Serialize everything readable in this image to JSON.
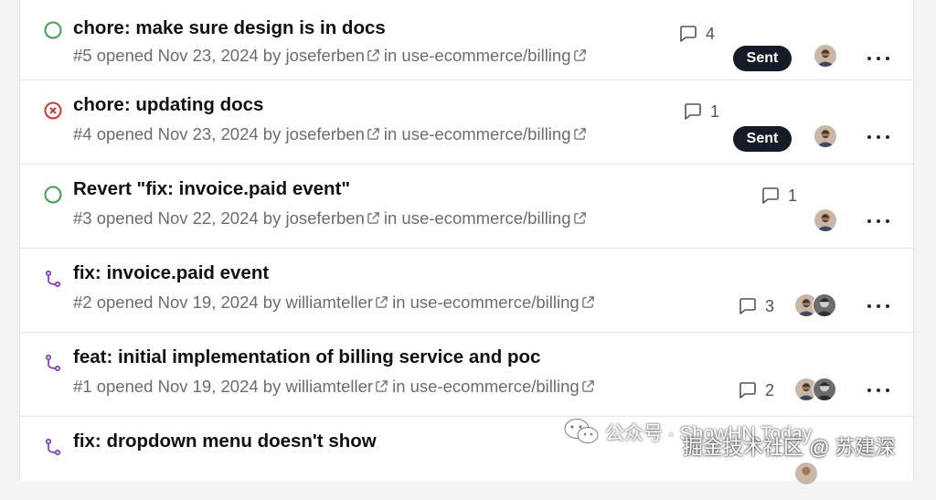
{
  "issues": [
    {
      "status": "open",
      "status_icon": "circle-open-icon",
      "title": "chore: make sure design is in docs",
      "meta_prefix": "#5 opened Nov 23, 2024 by",
      "author": "joseferben",
      "in_text": "in",
      "repo": "use-ecommerce/billing",
      "comment_count": "4",
      "badge": "Sent",
      "avatars": [
        "avatar-joseferben"
      ]
    },
    {
      "status": "closed",
      "status_icon": "circle-x-icon",
      "title": "chore: updating docs",
      "meta_prefix": "#4 opened Nov 23, 2024 by",
      "author": "joseferben",
      "in_text": "in",
      "repo": "use-ecommerce/billing",
      "comment_count": "1",
      "badge": "Sent",
      "avatars": [
        "avatar-joseferben"
      ]
    },
    {
      "status": "open",
      "status_icon": "circle-open-icon",
      "title": "Revert \"fix: invoice.paid event\"",
      "meta_prefix": "#3 opened Nov 22, 2024 by",
      "author": "joseferben",
      "in_text": "in",
      "repo": "use-ecommerce/billing",
      "comment_count": "1",
      "avatars": [
        "avatar-joseferben"
      ]
    },
    {
      "status": "pull-request",
      "status_icon": "git-pull-request-icon",
      "title": "fix: invoice.paid event",
      "meta_prefix": "#2 opened Nov 19, 2024 by",
      "author": "williamteller",
      "in_text": "in",
      "repo": "use-ecommerce/billing",
      "comment_count": "3",
      "avatars": [
        "avatar-joseferben",
        "avatar-williamteller"
      ]
    },
    {
      "status": "pull-request",
      "status_icon": "git-pull-request-icon",
      "title": "feat: initial implementation of billing service and poc",
      "meta_prefix": "#1 opened Nov 19, 2024 by",
      "author": "williamteller",
      "in_text": "in",
      "repo": "use-ecommerce/billing",
      "comment_count": "2",
      "avatars": [
        "avatar-joseferben",
        "avatar-williamteller"
      ]
    },
    {
      "status": "pull-request",
      "status_icon": "git-pull-request-icon",
      "title": "fix: dropdown menu doesn't show"
    }
  ],
  "more_icon": "ellipsis-icon",
  "comment_icon": "message-square-icon",
  "external_icon": "external-link-icon",
  "colors": {
    "open": "#3fa34d",
    "closed": "#d93636",
    "pull_request": "#8b3fd0",
    "badge_bg": "#171b27"
  },
  "watermark": {
    "line1": "公众号 · ShowHN Today",
    "line2": "掘金技术社区 @ 苏建深"
  }
}
